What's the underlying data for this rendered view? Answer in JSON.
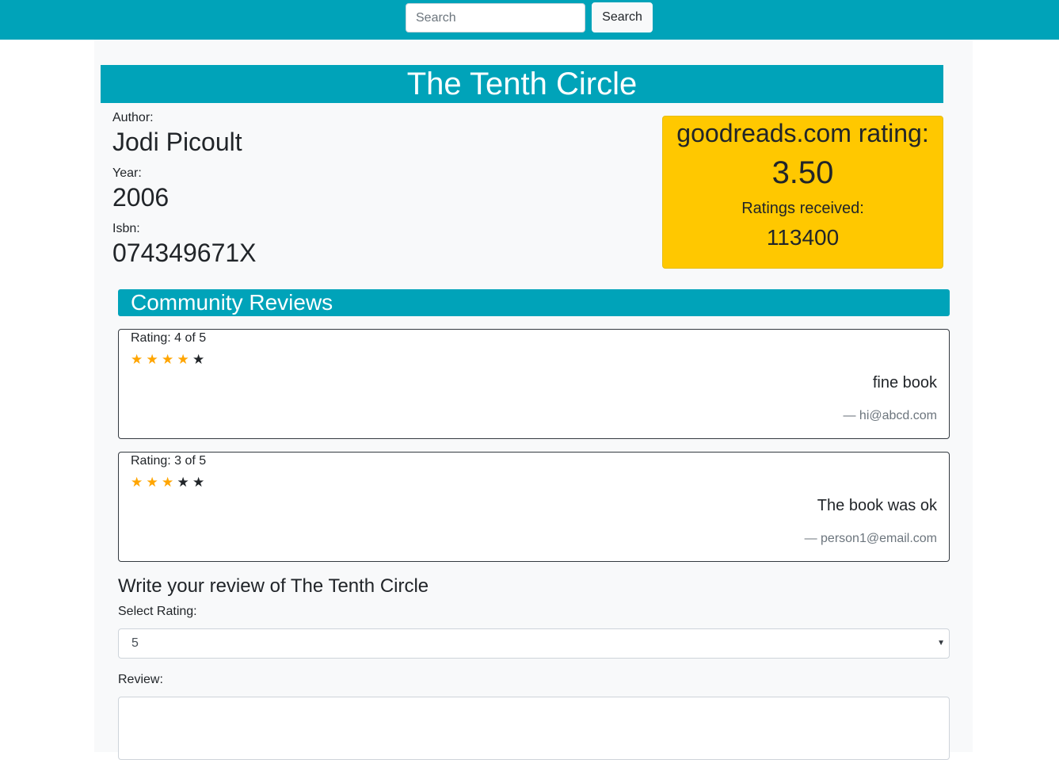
{
  "navbar": {
    "search_placeholder": "Search",
    "search_button": "Search"
  },
  "book": {
    "title": "The Tenth Circle",
    "author_label": "Author:",
    "author": "Jodi Picoult",
    "year_label": "Year:",
    "year": "2006",
    "isbn_label": "Isbn:",
    "isbn": "074349671X"
  },
  "goodreads": {
    "title": "goodreads.com rating:",
    "average": "3.50",
    "count_label": "Ratings received:",
    "count": "113400"
  },
  "community": {
    "header": "Community Reviews",
    "reviews": [
      {
        "rating_text": "Rating: 4 of 5",
        "rating": 4,
        "max": 5,
        "text": "fine book",
        "author": "— hi@abcd.com"
      },
      {
        "rating_text": "Rating: 3 of 5",
        "rating": 3,
        "max": 5,
        "text": "The book was ok",
        "author": "— person1@email.com"
      }
    ]
  },
  "form": {
    "heading": "Write your review of The Tenth Circle",
    "rating_label": "Select Rating:",
    "rating_value": "5",
    "review_label": "Review:",
    "review_value": ""
  },
  "colors": {
    "brand": "#00a3b9",
    "rating_box": "#ffc800",
    "star_on": "#ffa500",
    "star_off": "#212529"
  },
  "icons": {
    "star": "star-icon",
    "select_arrow": "chevron-down-icon"
  }
}
